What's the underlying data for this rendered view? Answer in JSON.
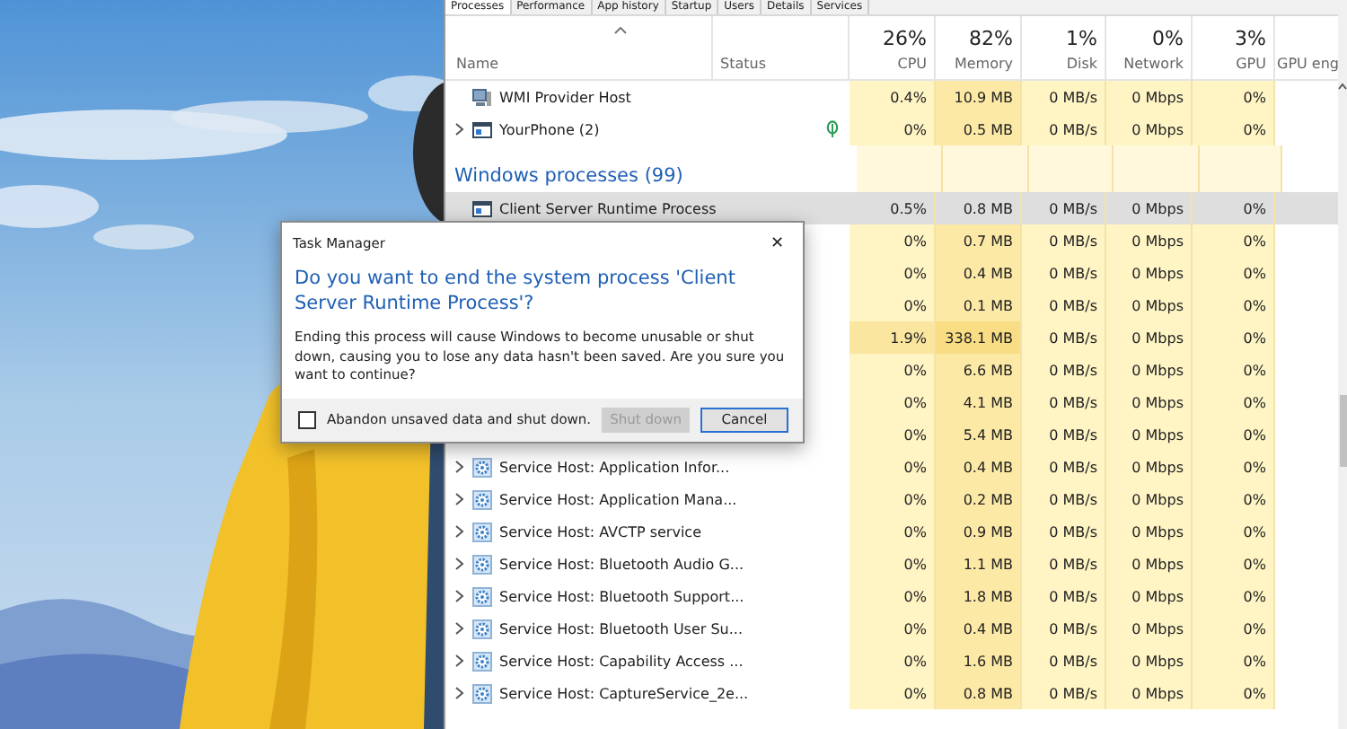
{
  "tabs": [
    {
      "label": "Processes",
      "selected": true
    },
    {
      "label": "Performance",
      "selected": false
    },
    {
      "label": "App history",
      "selected": false
    },
    {
      "label": "Startup",
      "selected": false
    },
    {
      "label": "Users",
      "selected": false
    },
    {
      "label": "Details",
      "selected": false
    },
    {
      "label": "Services",
      "selected": false
    }
  ],
  "name_column": "Name",
  "status_column": "Status",
  "metric_columns": [
    {
      "usage": "26%",
      "label": "CPU"
    },
    {
      "usage": "82%",
      "label": "Memory"
    },
    {
      "usage": "1%",
      "label": "Disk"
    },
    {
      "usage": "0%",
      "label": "Network"
    },
    {
      "usage": "3%",
      "label": "GPU"
    },
    {
      "label": "GPU eng"
    }
  ],
  "rows": [
    {
      "kind": "host",
      "name": "WMI Provider Host",
      "expandable": false,
      "efficiency_mode": false,
      "selected": false,
      "hot": false,
      "values": [
        "0.4%",
        "10.9 MB",
        "0 MB/s",
        "0 Mbps",
        "0%"
      ]
    },
    {
      "kind": "app",
      "name": "YourPhone (2)",
      "expandable": true,
      "efficiency_mode": true,
      "selected": false,
      "hot": false,
      "values": [
        "0%",
        "0.5 MB",
        "0 MB/s",
        "0 Mbps",
        "0%"
      ]
    },
    {
      "kind": "group",
      "name": "Windows processes (99)"
    },
    {
      "kind": "app",
      "name": "Client Server Runtime Process",
      "expandable": false,
      "efficiency_mode": false,
      "selected": true,
      "hot": false,
      "values": [
        "0.5%",
        "0.8 MB",
        "0 MB/s",
        "0 Mbps",
        "0%"
      ]
    },
    {
      "kind": "process",
      "selected": false,
      "hot": false,
      "values": [
        "0%",
        "0.7 MB",
        "0 MB/s",
        "0 Mbps",
        "0%"
      ]
    },
    {
      "kind": "process",
      "selected": false,
      "hot": false,
      "values": [
        "0%",
        "0.4 MB",
        "0 MB/s",
        "0 Mbps",
        "0%"
      ]
    },
    {
      "kind": "process",
      "selected": false,
      "hot": false,
      "values": [
        "0%",
        "0.1 MB",
        "0 MB/s",
        "0 Mbps",
        "0%"
      ]
    },
    {
      "kind": "process",
      "selected": false,
      "hot": true,
      "values": [
        "1.9%",
        "338.1 MB",
        "0 MB/s",
        "0 Mbps",
        "0%"
      ]
    },
    {
      "kind": "process",
      "selected": false,
      "hot": false,
      "values": [
        "0%",
        "6.6 MB",
        "0 MB/s",
        "0 Mbps",
        "0%"
      ]
    },
    {
      "kind": "process",
      "selected": false,
      "hot": false,
      "values": [
        "0%",
        "4.1 MB",
        "0 MB/s",
        "0 Mbps",
        "0%"
      ]
    },
    {
      "kind": "process",
      "selected": false,
      "hot": false,
      "values": [
        "0%",
        "5.4 MB",
        "0 MB/s",
        "0 Mbps",
        "0%"
      ]
    },
    {
      "kind": "service",
      "name": "Service Host: Application Infor...",
      "expandable": true,
      "efficiency_mode": false,
      "selected": false,
      "hot": false,
      "values": [
        "0%",
        "0.4 MB",
        "0 MB/s",
        "0 Mbps",
        "0%"
      ]
    },
    {
      "kind": "service",
      "name": "Service Host: Application Mana...",
      "expandable": true,
      "efficiency_mode": false,
      "selected": false,
      "hot": false,
      "values": [
        "0%",
        "0.2 MB",
        "0 MB/s",
        "0 Mbps",
        "0%"
      ]
    },
    {
      "kind": "service",
      "name": "Service Host: AVCTP service",
      "expandable": true,
      "efficiency_mode": false,
      "selected": false,
      "hot": false,
      "values": [
        "0%",
        "0.9 MB",
        "0 MB/s",
        "0 Mbps",
        "0%"
      ]
    },
    {
      "kind": "service",
      "name": "Service Host: Bluetooth Audio G...",
      "expandable": true,
      "efficiency_mode": false,
      "selected": false,
      "hot": false,
      "values": [
        "0%",
        "1.1 MB",
        "0 MB/s",
        "0 Mbps",
        "0%"
      ]
    },
    {
      "kind": "service",
      "name": "Service Host: Bluetooth Support...",
      "expandable": true,
      "efficiency_mode": false,
      "selected": false,
      "hot": false,
      "values": [
        "0%",
        "1.8 MB",
        "0 MB/s",
        "0 Mbps",
        "0%"
      ]
    },
    {
      "kind": "service",
      "name": "Service Host: Bluetooth User Su...",
      "expandable": true,
      "efficiency_mode": false,
      "selected": false,
      "hot": false,
      "values": [
        "0%",
        "0.4 MB",
        "0 MB/s",
        "0 Mbps",
        "0%"
      ]
    },
    {
      "kind": "service",
      "name": "Service Host: Capability Access ...",
      "expandable": true,
      "efficiency_mode": false,
      "selected": false,
      "hot": false,
      "values": [
        "0%",
        "1.6 MB",
        "0 MB/s",
        "0 Mbps",
        "0%"
      ]
    },
    {
      "kind": "service",
      "name": "Service Host: CaptureService_2e...",
      "expandable": true,
      "efficiency_mode": false,
      "selected": false,
      "hot": false,
      "values": [
        "0%",
        "0.8 MB",
        "0 MB/s",
        "0 Mbps",
        "0%"
      ]
    }
  ],
  "dialog": {
    "title": "Task Manager",
    "close": "✕",
    "heading": "Do you want to end the system process 'Client Server Runtime Process'?",
    "message": "Ending this process will cause Windows to become unusable or shut down, causing you to lose any data hasn't been saved. Are you sure you want to continue?",
    "checkbox": {
      "label": "Abandon unsaved data and shut down.",
      "checked": false
    },
    "buttons": [
      {
        "label": "Shut down",
        "disabled": true,
        "focused": false
      },
      {
        "label": "Cancel",
        "disabled": false,
        "focused": true
      }
    ]
  }
}
